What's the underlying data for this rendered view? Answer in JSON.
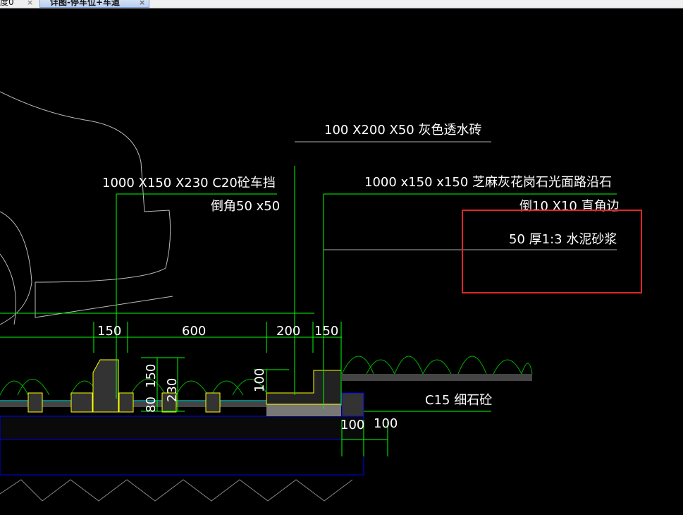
{
  "tabs": [
    {
      "label": "度0",
      "close": "×"
    },
    {
      "label": "详图-停车位+车道",
      "close": "×"
    }
  ],
  "annotations": {
    "paver": "100 X200 X50 灰色透水砖",
    "wheel_stop": "1000 X150 X230  C20砼车挡",
    "wheel_stop_chamfer": "倒角50 x50",
    "curb": "1000 x150 x150 芝麻灰花岗石光面路沿石",
    "curb_edge": "倒10 X10 直角边",
    "mortar": "50 厚1:3 水泥砂浆",
    "concrete": "C15 细石砼"
  },
  "dimensions": {
    "d150a": "150",
    "d600": "600",
    "d200": "200",
    "d150b": "150",
    "v150": "150",
    "v80": "80",
    "v230": "230",
    "v100": "100",
    "h100a": "100",
    "h100b": "100"
  },
  "colors": {
    "dim": "#00ff00",
    "edge": "#ffff00",
    "base": "#0000ff",
    "highlight": "#e0262a"
  }
}
